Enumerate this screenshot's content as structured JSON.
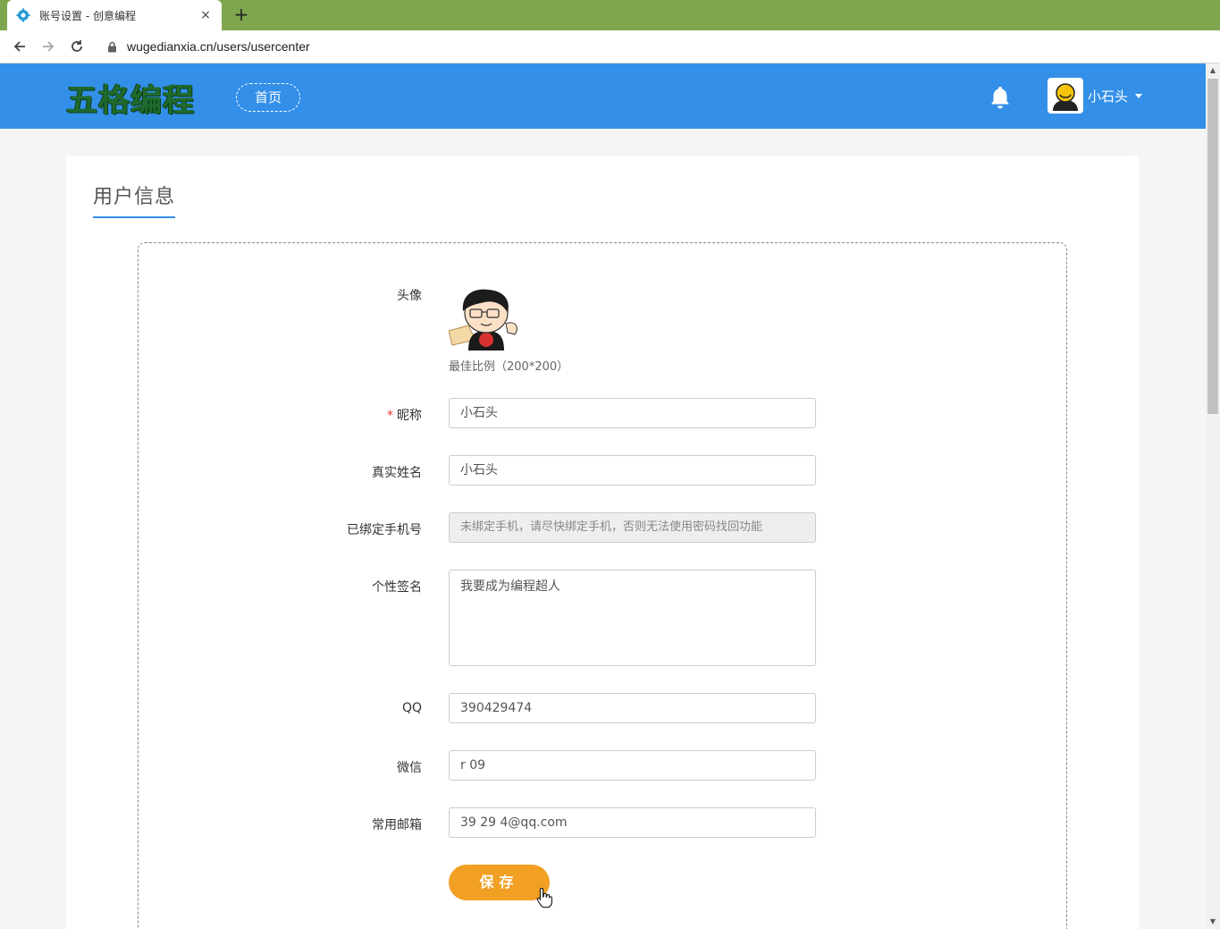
{
  "browser": {
    "tab_title": "账号设置 - 创意编程",
    "tab_close": "×",
    "new_tab": "+",
    "url": "wugedianxia.cn/users/usercenter"
  },
  "header": {
    "logo": "五格编程",
    "home_label": "首页",
    "user_name": "小石头",
    "brand_color": "#338fe8"
  },
  "page": {
    "title": "用户信息"
  },
  "form": {
    "avatar_label": "头像",
    "avatar_hint": "最佳比例（200*200）",
    "nickname_required": "*",
    "nickname_label": "昵称",
    "nickname_value": "小石头",
    "realname_label": "真实姓名",
    "realname_value": "小石头",
    "phone_label": "已绑定手机号",
    "phone_placeholder": "未绑定手机，请尽快绑定手机，否则无法使用密码找回功能",
    "signature_label": "个性签名",
    "signature_value": "我要成为编程超人",
    "qq_label": "QQ",
    "qq_value": "390429474",
    "wechat_label": "微信",
    "wechat_value": "r    09",
    "email_label": "常用邮箱",
    "email_value": "39   29  4@qq.com",
    "save_label": "保存"
  }
}
